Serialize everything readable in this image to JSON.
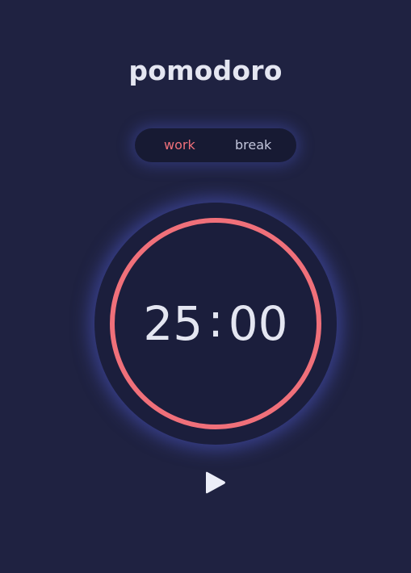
{
  "app": {
    "title": "pomodoro"
  },
  "mode_toggle": {
    "tabs": [
      {
        "label": "work",
        "active": true
      },
      {
        "label": "break",
        "active": false
      }
    ]
  },
  "timer": {
    "minutes": "25",
    "separator": ":",
    "seconds": "00",
    "progress": 1.0
  },
  "controls": {
    "play_icon": "play-icon"
  },
  "colors": {
    "background": "#1f2241",
    "accent": "#f0707a",
    "text": "#e4e6f1",
    "glow": "#5460dc"
  }
}
